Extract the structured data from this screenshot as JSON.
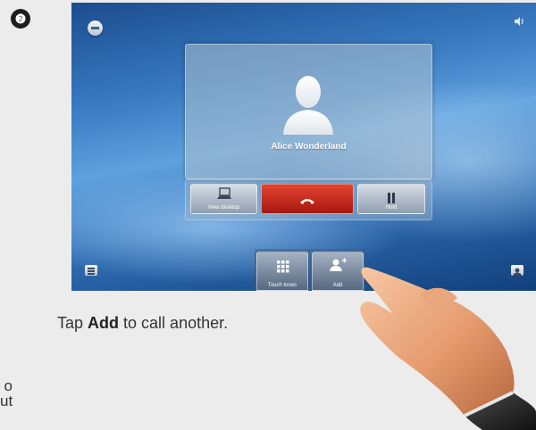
{
  "step": {
    "number": "❷"
  },
  "call": {
    "caller_name": "Alice Wonderland"
  },
  "controls": {
    "view_desktop": "View desktop",
    "end_call_icon": "handset-icon",
    "hold": "Hold"
  },
  "bottom_bar": {
    "touch_tones": "Touch tones",
    "add": "Add"
  },
  "instruction": {
    "prefix": "Tap ",
    "bold": "Add",
    "suffix": " to call another."
  },
  "edge_text": {
    "line1": "o",
    "line2": "ut"
  },
  "colors": {
    "end_call": "#c8281c",
    "background": "#ececec"
  }
}
